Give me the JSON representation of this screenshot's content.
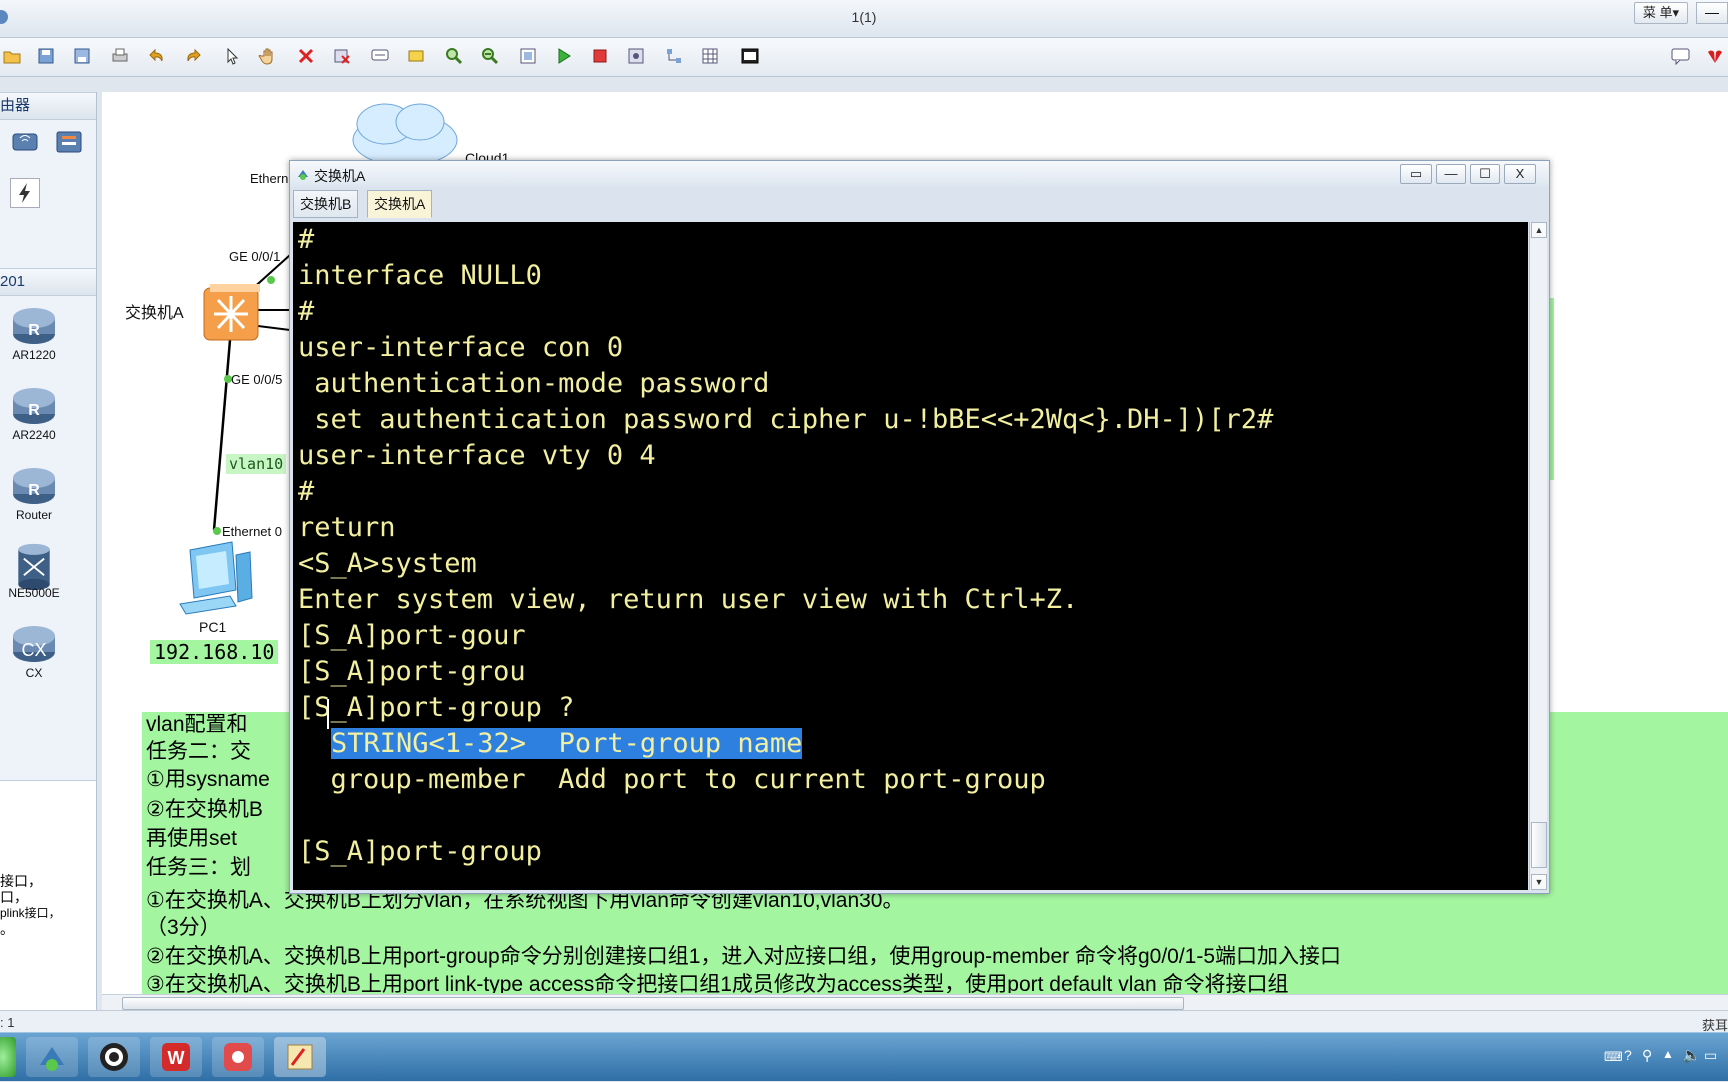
{
  "app": {
    "title": "1(1)",
    "menu_label": "菜 单▾",
    "min_label": "—"
  },
  "left_panel": {
    "section1_header": "由器",
    "section2_header": "201",
    "devices": [
      {
        "label": "AR1220"
      },
      {
        "label": "AR2240"
      },
      {
        "label": "Router"
      },
      {
        "label": "NE5000E"
      },
      {
        "label": "CX"
      }
    ],
    "desc_lines": [
      "接口，",
      "口，",
      "plink接口，",
      "。"
    ]
  },
  "topology": {
    "cloud_label": "Cloud1",
    "ethernet_top_label": "Ethern",
    "ge_top_label": "GE 0/0/1",
    "switch_label": "交换机A",
    "ge_bottom_label": "GE 0/0/5",
    "vlan_tag": "vlan10",
    "ethernet_pc_label": "Ethernet 0",
    "pc_label": "PC1",
    "ip_label": "192.168.10"
  },
  "task_text": {
    "line1": "vlan配置和",
    "line2": "任务二：交",
    "line3": "①用sysname",
    "line4": "②在交换机B",
    "line5": "再使用set",
    "line6": "任务三：划",
    "line7": "①在交换机A、交换机B上划分vlan，在系统视图下用vlan命令创建vlan10,vlan30。",
    "line8": "（3分）",
    "line9": "②在交换机A、交换机B上用port-group命令分别创建接口组1，进入对应接口组，使用group-member 命令将g0/0/1-5端口加入接口",
    "line10": "③在交换机A、交换机B上用port link-type access命令把接口组1成员修改为access类型，使用port default vlan 命令将接口组"
  },
  "console": {
    "title": "交换机A",
    "restore_label": "▭",
    "min_label": "—",
    "max_label": "☐",
    "close_label": "X",
    "tabs": [
      {
        "label": "交换机B",
        "active": false
      },
      {
        "label": "交换机A",
        "active": true
      }
    ],
    "lines": [
      "#",
      "interface NULL0",
      "#",
      "user-interface con 0",
      " authentication-mode password",
      " set authentication password cipher u-!bBE<<+2Wq<}.DH-])[r2#",
      "user-interface vty 0 4",
      "#",
      "return",
      "<S_A>system",
      "Enter system view, return user view with Ctrl+Z.",
      "[S_A]port-gour",
      "[S_A]port-grou",
      "[S_A]port-group ?",
      "  STRING<1-32>  Port-group name",
      "  group-member  Add port to current port-group",
      "",
      "[S_A]port-group"
    ],
    "highlighted_text": "STRING<1-32>  Port-group name"
  },
  "status": {
    "left_text": ": 1",
    "right_text": "获耳"
  },
  "colors": {
    "terminal_text": "#f2f0a0",
    "terminal_bg": "#000000",
    "highlight": "#2d7fe0",
    "task_bg": "#a4f5a0"
  }
}
